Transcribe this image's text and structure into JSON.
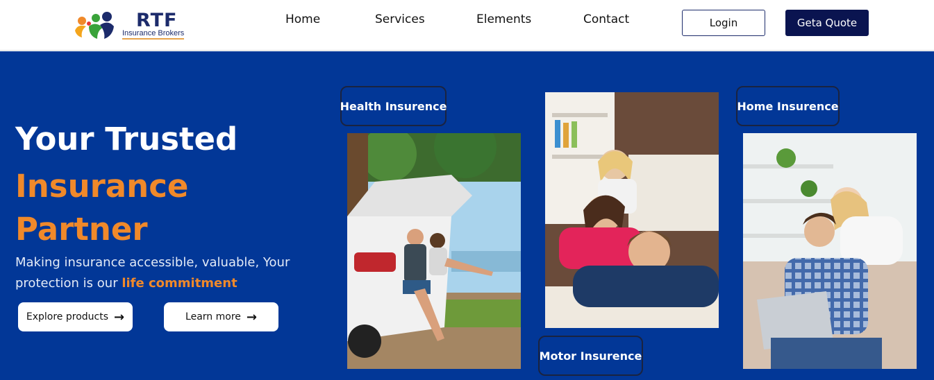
{
  "brand": {
    "title": "RTF",
    "subtitle": "Insurance Brokers",
    "colors": {
      "primary": "#023797",
      "accent": "#f0892a",
      "navy": "#0a1450"
    }
  },
  "nav": {
    "items": [
      {
        "label": "Home"
      },
      {
        "label": "Services"
      },
      {
        "label": "Elements"
      },
      {
        "label": "Contact"
      }
    ],
    "login_label": "Login",
    "quote_label": "Geta Quote"
  },
  "hero": {
    "headline_line1": "Your Trusted",
    "headline_line2": "Insurance",
    "headline_line3": "Partner",
    "lede_text": "Making insurance accessible, valuable, Your protection is our ",
    "lede_highlight": "life commitment",
    "explore_label": "Explore products",
    "learn_label": "Learn more",
    "arrow_icon": "arrow-right-icon"
  },
  "cards": {
    "health_label": "Health Insurence",
    "home_label": "Home Insurence",
    "motor_label": "Motor Insurence"
  }
}
